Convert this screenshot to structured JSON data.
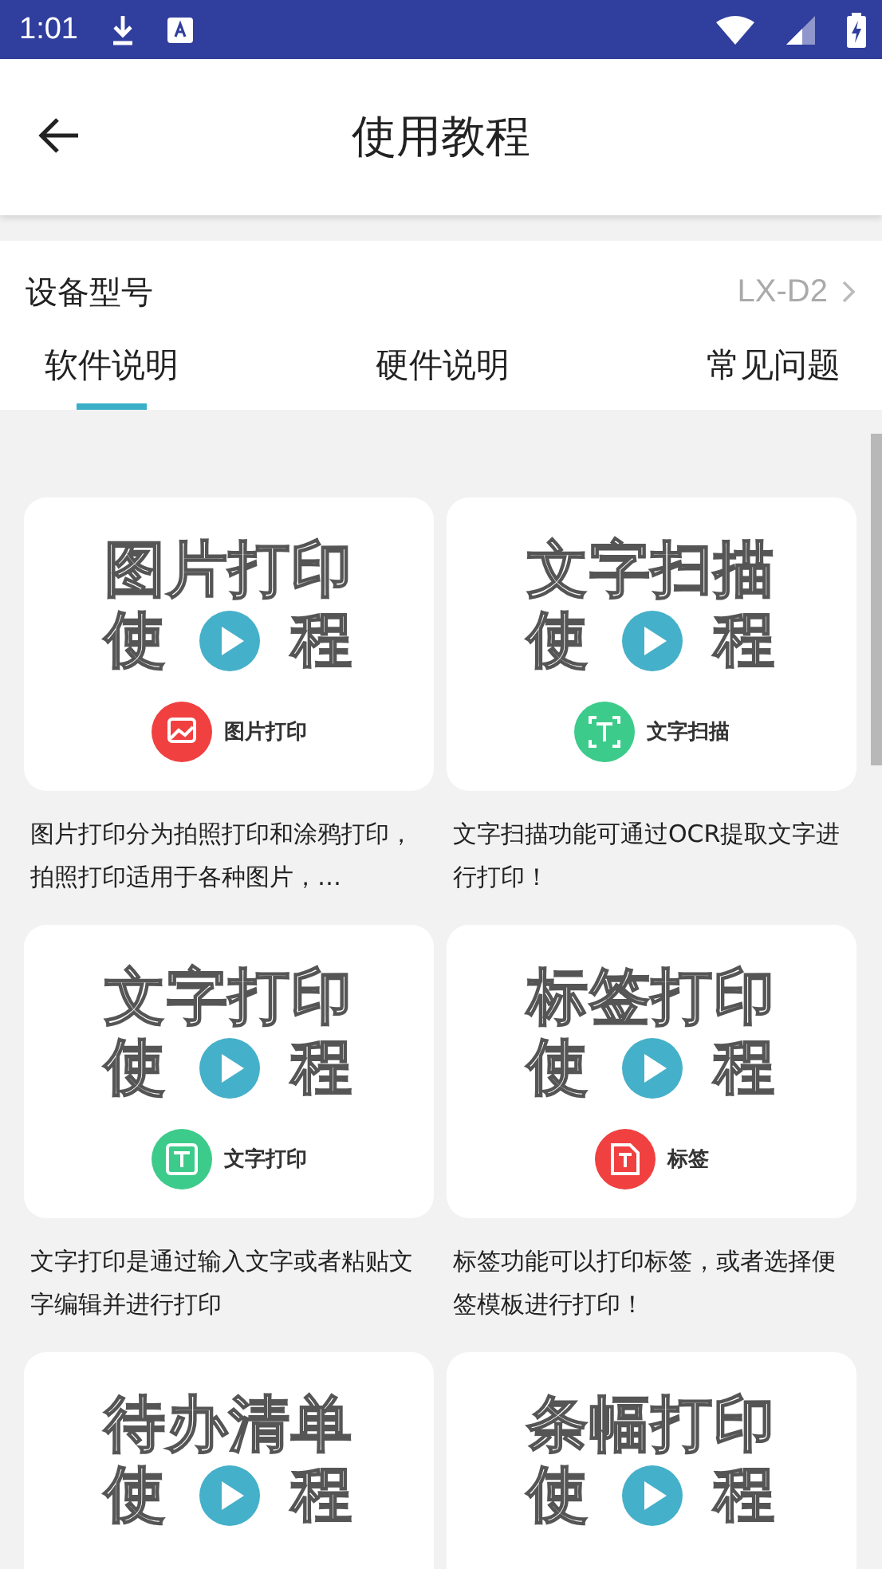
{
  "status_bar": {
    "time": "1:01"
  },
  "app_bar": {
    "title": "使用教程"
  },
  "device": {
    "label": "设备型号",
    "value": "LX-D2"
  },
  "tabs": [
    {
      "label": "软件说明",
      "selected": true
    },
    {
      "label": "硬件说明",
      "selected": false
    },
    {
      "label": "常见问题",
      "selected": false
    }
  ],
  "tutorials": [
    {
      "cover_title": "图片打印",
      "cover_subtitle": [
        "使",
        "程"
      ],
      "badge": {
        "label": "图片打印",
        "color": "#f04040",
        "kind": "image"
      },
      "description": "图片打印分为拍照打印和涂鸦打印，拍照打印适用于各种图片，…"
    },
    {
      "cover_title": "文字扫描",
      "cover_subtitle": [
        "使",
        "程"
      ],
      "badge": {
        "label": "文字扫描",
        "color": "#3ccb8a",
        "kind": "scan"
      },
      "description": "文字扫描功能可通过OCR提取文字进行打印！"
    },
    {
      "cover_title": "文字打印",
      "cover_subtitle": [
        "使",
        "程"
      ],
      "badge": {
        "label": "文字打印",
        "color": "#3ccb8a",
        "kind": "text"
      },
      "description": "文字打印是通过输入文字或者粘贴文字编辑并进行打印"
    },
    {
      "cover_title": "标签打印",
      "cover_subtitle": [
        "使",
        "程"
      ],
      "badge": {
        "label": "标签",
        "color": "#f04040",
        "kind": "label"
      },
      "description": "标签功能可以打印标签，或者选择便签模板进行打印！"
    },
    {
      "cover_title": "待办清单",
      "cover_subtitle": [
        "使",
        "程"
      ]
    },
    {
      "cover_title": "条幅打印",
      "cover_subtitle": [
        "使",
        "程"
      ]
    }
  ]
}
